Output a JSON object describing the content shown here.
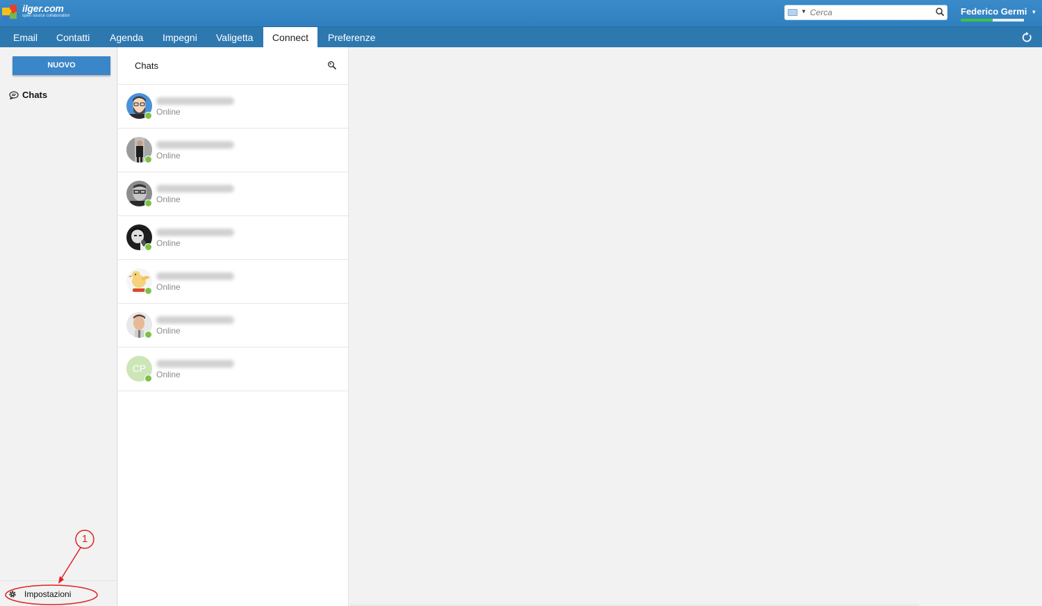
{
  "app": {
    "logo_text": "ilger.com",
    "logo_subtitle": "open source collaboration"
  },
  "header": {
    "search_placeholder": "Cerca",
    "user_name": "Federico Germi",
    "user_quota_used_fraction": 0.5
  },
  "nav": {
    "items": [
      {
        "label": "Email"
      },
      {
        "label": "Contatti"
      },
      {
        "label": "Agenda"
      },
      {
        "label": "Impegni"
      },
      {
        "label": "Valigetta"
      },
      {
        "label": "Connect",
        "active": true
      },
      {
        "label": "Preferenze"
      }
    ]
  },
  "sidebar": {
    "new_button": "NUOVO",
    "chats_label": "Chats",
    "settings_label": "Impostazioni"
  },
  "chatlist": {
    "title": "Chats",
    "contacts": [
      {
        "status": "Online",
        "avatar": "illustrated-bearded-man",
        "initials": ""
      },
      {
        "status": "Online",
        "avatar": "photo-standing-man",
        "initials": ""
      },
      {
        "status": "Online",
        "avatar": "photo-man-glasses",
        "initials": ""
      },
      {
        "status": "Online",
        "avatar": "photo-bw-man",
        "initials": ""
      },
      {
        "status": "Online",
        "avatar": "cartoon-chick",
        "initials": ""
      },
      {
        "status": "Online",
        "avatar": "photo-young-man",
        "initials": ""
      },
      {
        "status": "Online",
        "avatar": "initials",
        "initials": "CP"
      }
    ]
  },
  "annotation": {
    "number": "1"
  },
  "colors": {
    "header_blue": "#3b8bca",
    "nav_blue": "#2e78b0",
    "button_blue": "#3a86c8",
    "presence_green": "#7cc242",
    "annotation_red": "#e02020"
  }
}
